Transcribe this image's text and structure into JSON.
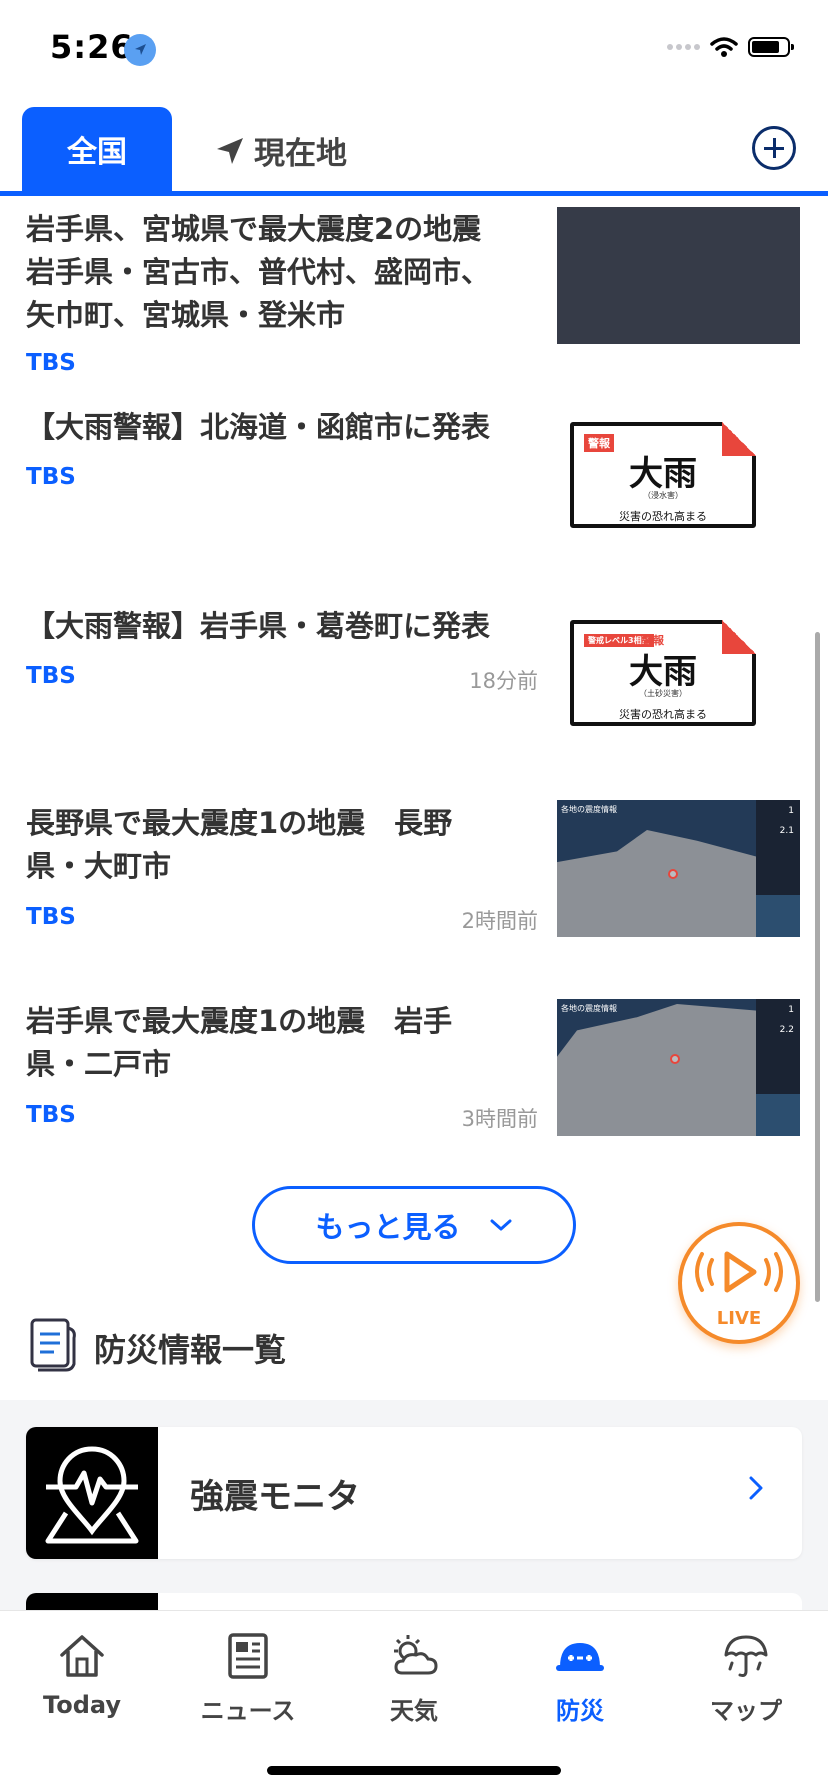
{
  "status": {
    "time": "5:26"
  },
  "tabs": {
    "active": "全国",
    "current": "現在地"
  },
  "news": [
    {
      "title_lines": [
        "岩手県、宮城県で最大震度2の地震",
        "岩手県・宮古市、普代村、盛岡市、",
        "矢巾町、宮城県・登米市"
      ],
      "source": "TBS",
      "time": ""
    },
    {
      "title_lines": [
        "【大雨警報】北海道・函館市に発表"
      ],
      "source": "TBS",
      "time": "",
      "thumb": {
        "tag": "警報",
        "big": "大雨",
        "small": "（浸水害）",
        "bottom": "災害の恐れ高まる"
      }
    },
    {
      "title_lines": [
        "【大雨警報】岩手県・葛巻町に発表"
      ],
      "source": "TBS",
      "time": "18分前",
      "thumb": {
        "tag": "警戒レベル3相当",
        "tag2": "警報",
        "big": "大雨",
        "small": "（土砂災害）",
        "bottom": "災害の恐れ高まる"
      }
    },
    {
      "title_lines": [
        "長野県で最大震度1の地震　長野",
        "県・大町市"
      ],
      "source": "TBS",
      "time": "2時間前",
      "thumb": {
        "header": "各地の震度情報",
        "panel_values": [
          "1",
          "2.1"
        ]
      }
    },
    {
      "title_lines": [
        "岩手県で最大震度1の地震　岩手",
        "県・二戸市"
      ],
      "source": "TBS",
      "time": "3時間前",
      "thumb": {
        "header": "各地の震度情報",
        "panel_values": [
          "1",
          "2.2"
        ]
      }
    }
  ],
  "more_button": "もっと見る",
  "live_label": "LIVE",
  "disaster": {
    "title": "防災情報一覧",
    "items": [
      {
        "label": "強震モニタ"
      }
    ]
  },
  "tabbar": [
    {
      "label": "Today",
      "icon": "home-icon"
    },
    {
      "label": "ニュース",
      "icon": "newspaper-icon"
    },
    {
      "label": "天気",
      "icon": "weather-icon"
    },
    {
      "label": "防災",
      "icon": "helmet-icon",
      "active": true
    },
    {
      "label": "マップ",
      "icon": "umbrella-map-icon"
    }
  ],
  "colors": {
    "accent": "#0b5fff",
    "live": "#f58a2a",
    "warning": "#e8463c"
  }
}
